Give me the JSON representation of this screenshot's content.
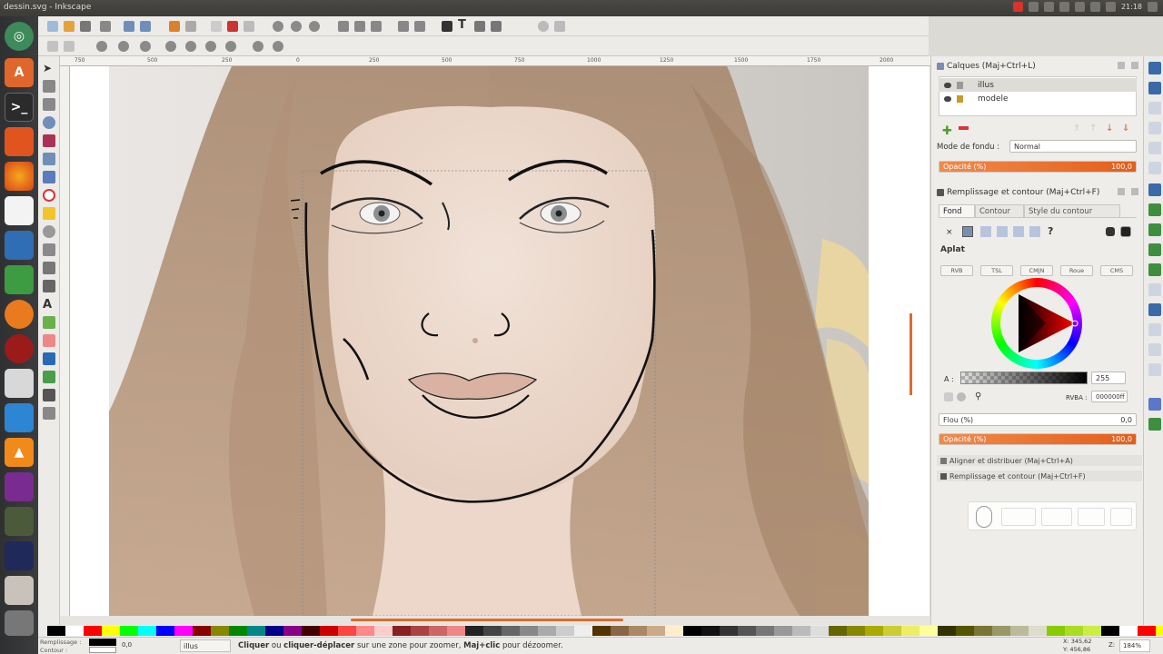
{
  "window": {
    "title": "dessin.svg - Inkscape",
    "clock": "21:18"
  },
  "rulers": {
    "h_ticks": [
      "750",
      "500",
      "250",
      "0",
      "250",
      "500",
      "750",
      "1000",
      "1250",
      "1500",
      "1750",
      "2000"
    ]
  },
  "layers_panel": {
    "title": "Calques (Maj+Ctrl+L)",
    "layers": [
      {
        "name": "illus"
      },
      {
        "name": "modele"
      }
    ],
    "blend_label": "Mode de fondu :",
    "blend_value": "Normal",
    "opacity_label": "Opacité (%)",
    "opacity_value": "100,0"
  },
  "fill_panel": {
    "title": "Remplissage et contour (Maj+Ctrl+F)",
    "tabs": [
      "Fond",
      "Contour",
      "Style du contour"
    ],
    "flat_label": "Aplat",
    "modes": [
      "RVB",
      "TSL",
      "CMJN",
      "Roue",
      "CMS"
    ],
    "alpha_label": "A :",
    "alpha_value": "255",
    "rgba_label": "RVBA :",
    "rgba_value": "000000ff",
    "blur_label": "Flou (%)",
    "blur_value": "0,0",
    "opacity_label": "Opacité (%)",
    "opacity_value": "100,0"
  },
  "collapsed_panels": [
    "Aligner et distribuer (Maj+Ctrl+A)",
    "Remplissage et contour (Maj+Ctrl+F)"
  ],
  "status": {
    "fill_label": "Remplissage :",
    "stroke_label": "Contour :",
    "stroke_width": "0,0",
    "layer": "illus",
    "message_bold1": "Cliquer",
    "message_1": " ou ",
    "message_bold2": "cliquer-déplacer",
    "message_2": " sur une zone pour zoomer, ",
    "message_bold3": "Maj+clic",
    "message_3": " pour dézoomer.",
    "coords_x": "X: 345,62",
    "coords_y": "Y: 456,86",
    "zoom_label": "Z:",
    "zoom": "184%"
  },
  "colors": {
    "accent": "#e35f19",
    "launcher": "#3b3c3e",
    "panel": "#eeedea"
  },
  "icons": {
    "launcher": [
      "dash-icon",
      "software-center-icon",
      "terminal-icon",
      "files-icon",
      "firefox-icon",
      "text-editor-icon",
      "writer-icon",
      "calc-icon",
      "blender-icon",
      "color-app-icon",
      "scanner-icon",
      "dropbox-icon",
      "vlc-icon",
      "terminal-purple-icon",
      "game-icon",
      "audio-icon",
      "window-icon",
      "trash-icon"
    ]
  }
}
